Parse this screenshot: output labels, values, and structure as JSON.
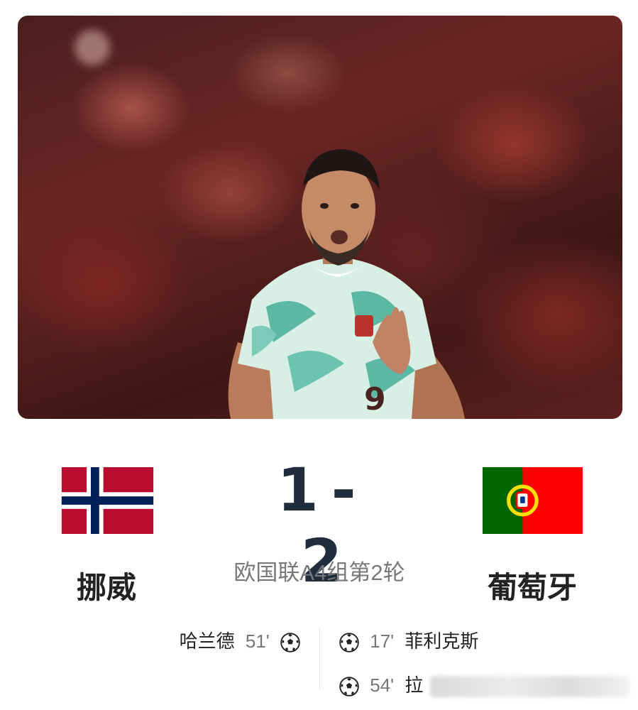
{
  "hero": {
    "image": "portugal-player-celebration-photo"
  },
  "match": {
    "home_team": "挪威",
    "away_team": "葡萄牙",
    "home_score": "1",
    "separator": "-",
    "away_score": "2",
    "round": "欧国联A4组第2轮"
  },
  "goals": {
    "home": [
      {
        "player": "哈兰德",
        "minute": "51'"
      }
    ],
    "away": [
      {
        "player": "菲利克斯",
        "minute": "17'"
      },
      {
        "player": "拉",
        "minute": "54'"
      }
    ]
  },
  "colors": {
    "score": "#1f2d3d",
    "norway_red": "#ba0c2f",
    "norway_blue": "#00205b",
    "portugal_green": "#006600",
    "portugal_red": "#ff0000"
  }
}
